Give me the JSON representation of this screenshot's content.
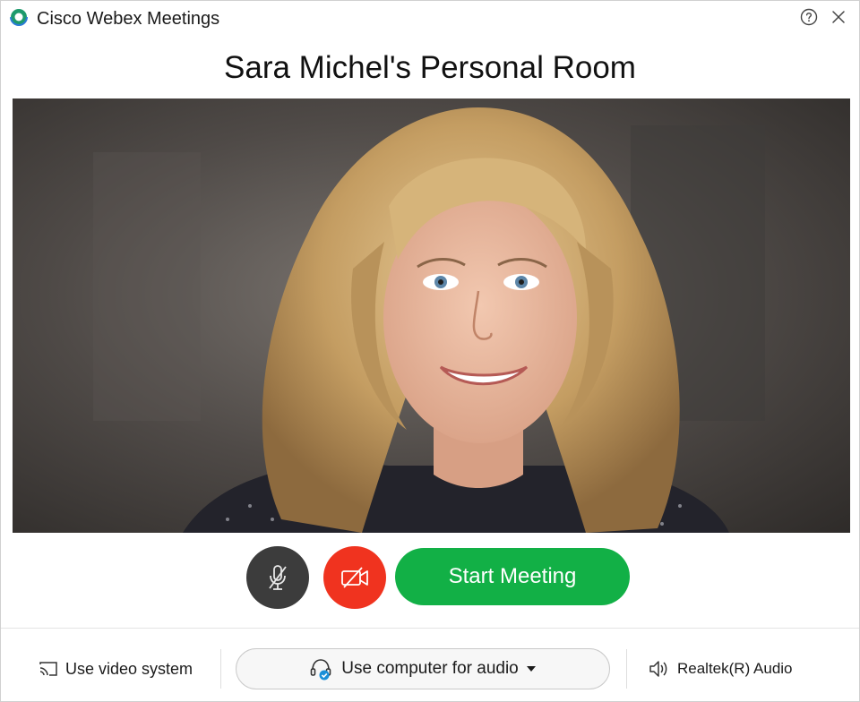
{
  "window": {
    "app_title": "Cisco Webex Meetings",
    "help_icon": "help-circle-icon",
    "close_icon": "close-icon"
  },
  "room": {
    "title": "Sara Michel's Personal Room"
  },
  "controls": {
    "mute_icon": "microphone-muted-icon",
    "video_icon": "video-off-icon",
    "start_label": "Start Meeting"
  },
  "bottom_bar": {
    "video_system_label": "Use video system",
    "audio_label": "Use computer for audio",
    "speaker_label": "Realtek(R) Audio"
  },
  "colors": {
    "start_green": "#12b046",
    "video_off_red": "#f0331f",
    "mute_dark": "#3c3c3c",
    "audio_check_blue": "#1a8fd8"
  }
}
